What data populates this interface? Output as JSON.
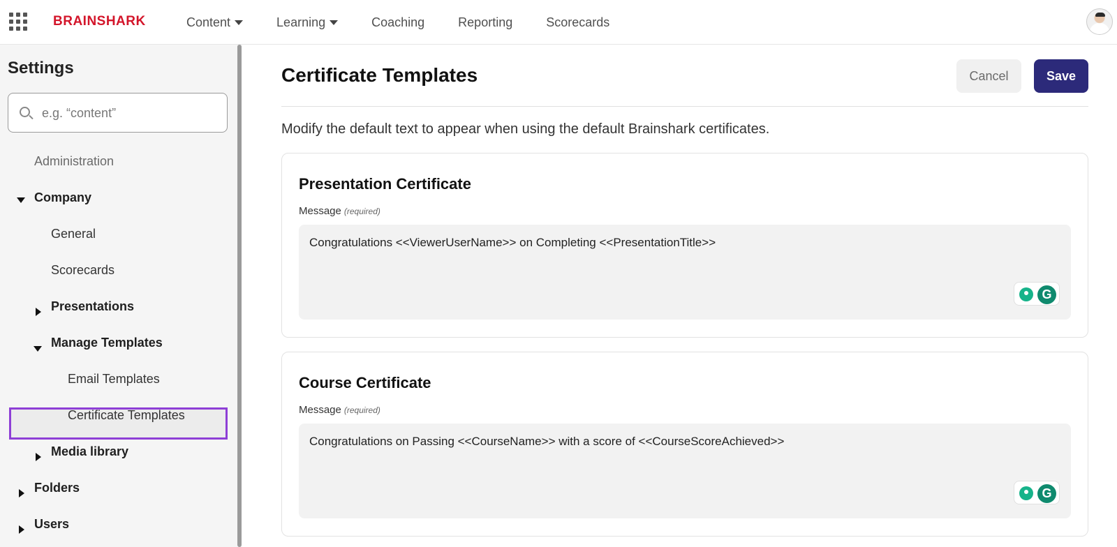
{
  "brand": {
    "name": "BRAINSHARK",
    "color": "#d3152a"
  },
  "nav": {
    "items": [
      {
        "label": "Content",
        "dropdown": true
      },
      {
        "label": "Learning",
        "dropdown": true
      },
      {
        "label": "Coaching",
        "dropdown": false
      },
      {
        "label": "Reporting",
        "dropdown": false
      },
      {
        "label": "Scorecards",
        "dropdown": false
      }
    ]
  },
  "sidebar": {
    "title": "Settings",
    "search": {
      "placeholder": "e.g. “content”",
      "value": ""
    },
    "items": {
      "administration": "Administration",
      "company": "Company",
      "general": "General",
      "scorecards": "Scorecards",
      "presentations": "Presentations",
      "manage_templates": "Manage Templates",
      "email_templates": "Email Templates",
      "certificate_templates": "Certificate Templates",
      "media_library": "Media library",
      "folders": "Folders",
      "users": "Users"
    },
    "selected": "Certificate Templates",
    "selected_color": "#8e3fd6"
  },
  "main": {
    "title": "Certificate Templates",
    "cancel_label": "Cancel",
    "save_label": "Save",
    "intro": "Modify the default text to appear when using the default Brainshark certificates.",
    "cards": [
      {
        "title": "Presentation Certificate",
        "field_label": "Message",
        "required_label": "(required)",
        "value": "Congratulations <<ViewerUserName>> on Completing <<PresentationTitle>>"
      },
      {
        "title": "Course Certificate",
        "field_label": "Message",
        "required_label": "(required)",
        "value": "Congratulations on Passing <<CourseName>> with a score of <<CourseScoreAchieved>>"
      }
    ],
    "grammarly_letter": "G"
  },
  "colors": {
    "save_button": "#2c2a7a",
    "grammarly": "#0f8a6e"
  }
}
